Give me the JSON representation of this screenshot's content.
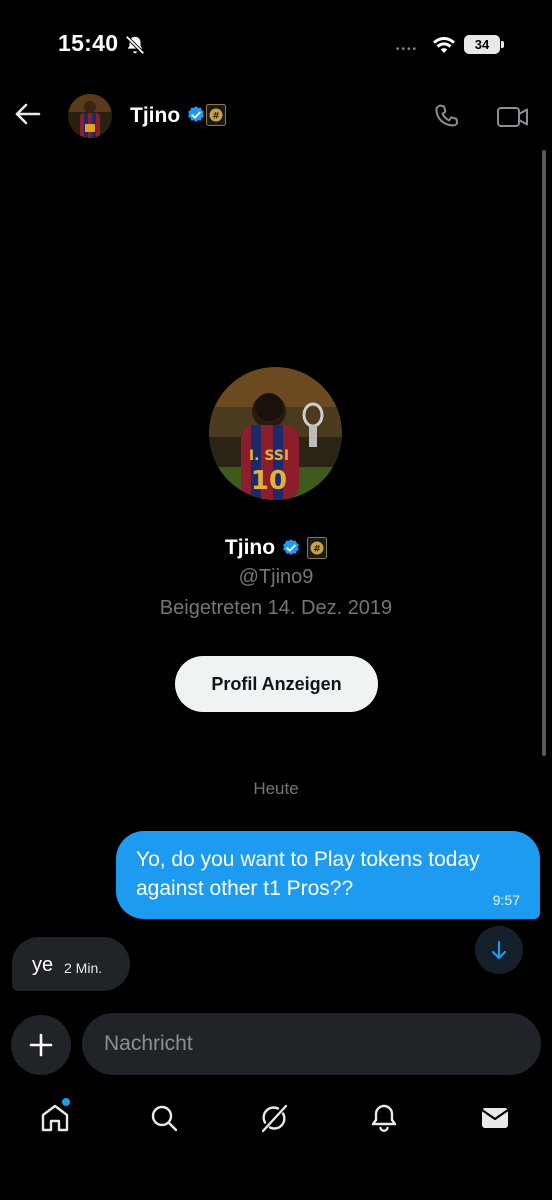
{
  "status_bar": {
    "time": "15:40",
    "signal": "••••",
    "battery": "34"
  },
  "header": {
    "name": "Tjino"
  },
  "profile": {
    "name": "Tjino",
    "handle": "@Tjino9",
    "joined": "Beigetreten 14. Dez. 2019",
    "button_label": "Profil Anzeigen"
  },
  "conversation": {
    "day_separator": "Heute",
    "messages": [
      {
        "direction": "outgoing",
        "text": "Yo, do you want to Play tokens today against other t1 Pros??",
        "time": "9:57"
      },
      {
        "direction": "incoming",
        "text": "ye",
        "time": "2 Min."
      }
    ]
  },
  "composer": {
    "placeholder": "Nachricht"
  },
  "icons": {
    "back": "arrow-left-icon",
    "call": "phone-icon",
    "video": "video-camera-icon",
    "verified": "verified-badge-icon",
    "affiliate": "affiliate-badge-icon",
    "scroll_down": "arrow-down-icon",
    "add": "plus-icon",
    "nav": [
      "home-icon",
      "search-icon",
      "grok-icon",
      "notifications-icon",
      "messages-icon"
    ]
  },
  "colors": {
    "accent": "#1d9bf0",
    "bubble_incoming": "#202327",
    "background": "#000000"
  }
}
